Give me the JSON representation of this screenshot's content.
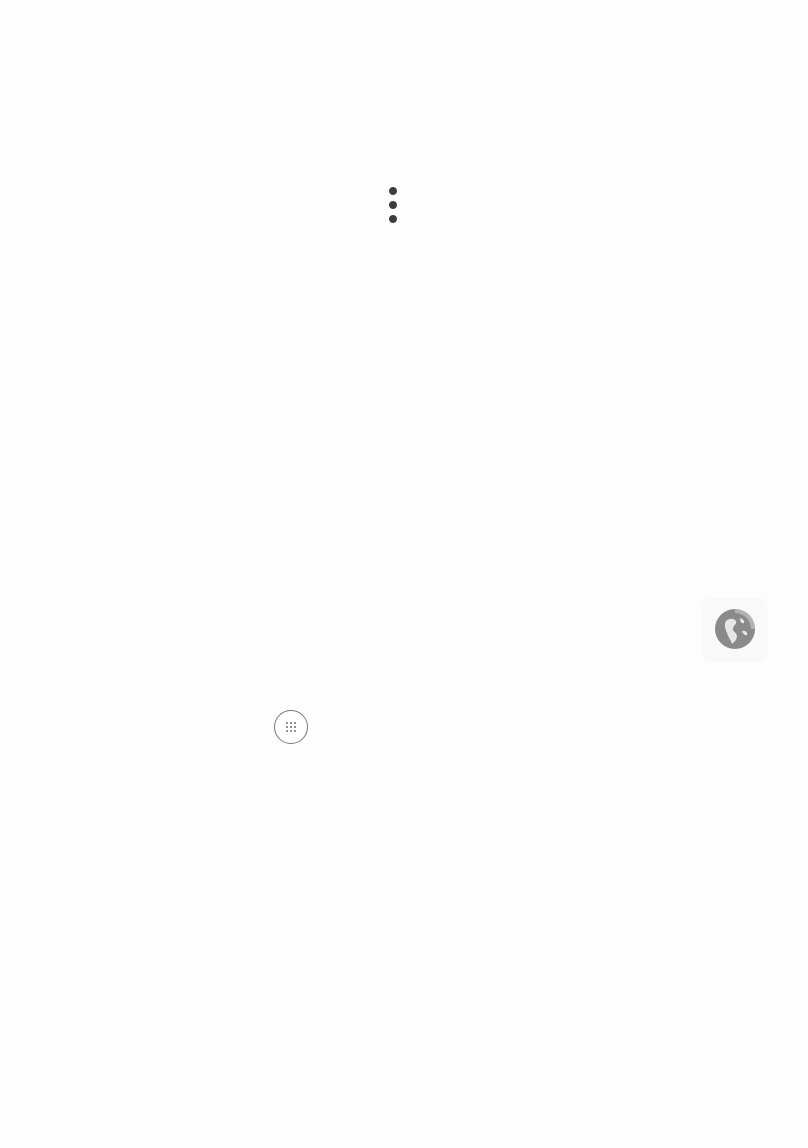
{
  "home_screen": {
    "overflow_menu": {
      "icon": "more-vert-icon"
    },
    "dock": {
      "browser_shortcut": {
        "icon": "globe-icon",
        "color": "#8a8a8a"
      },
      "app_drawer": {
        "icon": "app-drawer-grid-icon"
      }
    }
  },
  "colors": {
    "background": "#fdfdfd",
    "icon_dark": "#3d3d3d",
    "icon_grey": "#8a8a8a"
  }
}
